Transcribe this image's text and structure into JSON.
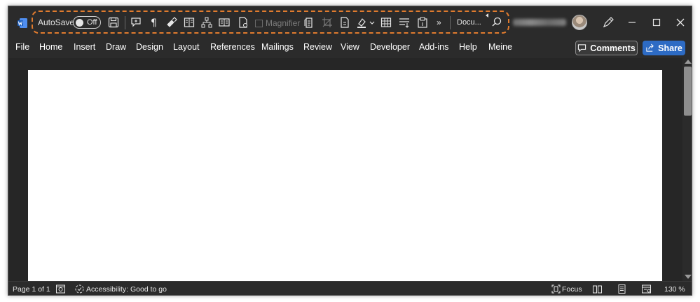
{
  "window": {
    "app": "Word"
  },
  "qat": {
    "autosave_label": "AutoSave",
    "autosave_state": "Off",
    "magnifier_label": "Magnifier",
    "document_name": "Docu..."
  },
  "menu": {
    "tabs": [
      "File",
      "Home",
      "Insert",
      "Draw",
      "Design",
      "Layout",
      "References",
      "Mailings",
      "Review",
      "View",
      "Developer",
      "Add-ins",
      "Help",
      "Meine"
    ],
    "comments_label": "Comments",
    "share_label": "Share"
  },
  "status": {
    "page_info": "Page 1 of 1",
    "accessibility": "Accessibility: Good to go",
    "focus_label": "Focus",
    "zoom": "130 %"
  },
  "colors": {
    "qat_outline": "#e07b2e",
    "share_button": "#2d6bc4",
    "chrome_background": "#2b2b2b",
    "word_blue": "#2b6ed6"
  }
}
